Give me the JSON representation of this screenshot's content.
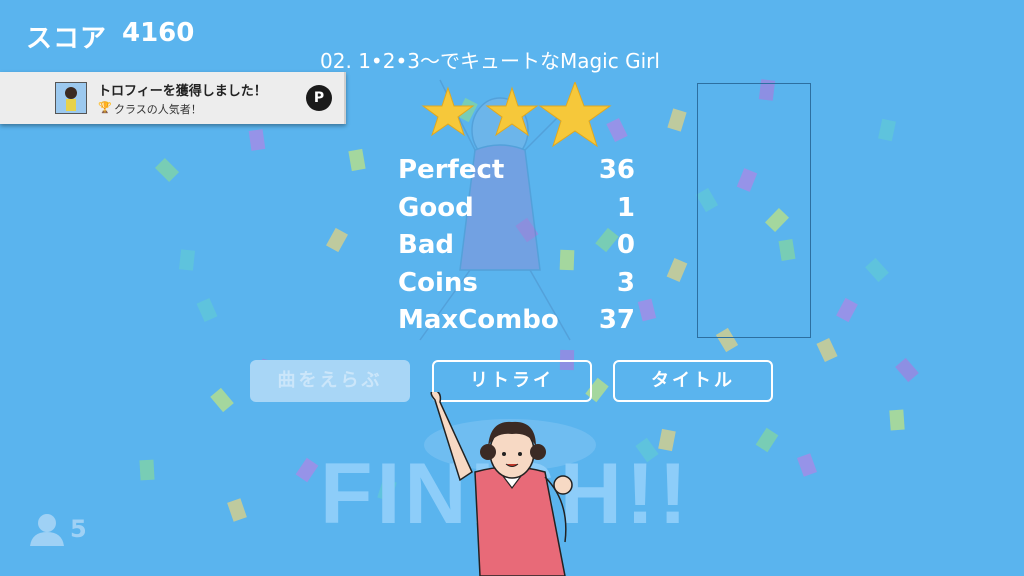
{
  "header": {
    "score_label": "スコア",
    "score_value": "4160"
  },
  "song": {
    "title": "02. 1•2•3〜でキュートなMagic Girl"
  },
  "trophy": {
    "title": "トロフィーを獲得しました！",
    "subtitle": "クラスの人気者！",
    "cup_icon": "trophy-icon",
    "platform_icon": "playstation-icon"
  },
  "rating": {
    "stars": 3
  },
  "results": [
    {
      "label": "Perfect",
      "value": "36"
    },
    {
      "label": "Good",
      "value": "1"
    },
    {
      "label": "Bad",
      "value": "0"
    },
    {
      "label": "Coins",
      "value": "3"
    },
    {
      "label": "MaxCombo",
      "value": "37"
    }
  ],
  "buttons": {
    "select_song": "曲をえらぶ",
    "retry": "リトライ",
    "title": "タイトル"
  },
  "finish_text": "FINISH!!",
  "players": {
    "icon": "user-icon",
    "count": "5"
  },
  "colors": {
    "background": "#5ab4ee",
    "star": "#f6c83a",
    "button_disabled": "#a8d6f6"
  }
}
